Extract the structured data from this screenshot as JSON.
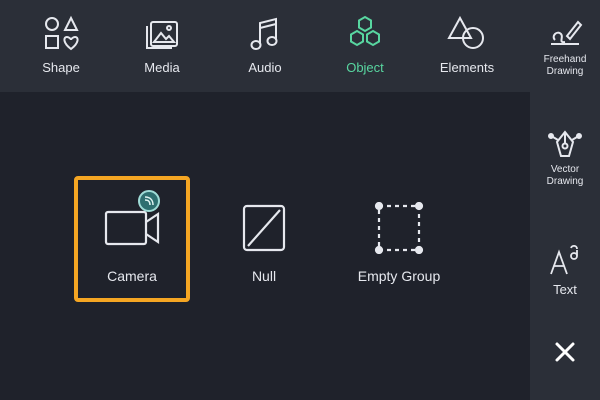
{
  "toolbar": {
    "tabs": [
      {
        "label": "Shape",
        "icon": "shapes-icon"
      },
      {
        "label": "Media",
        "icon": "media-icon"
      },
      {
        "label": "Audio",
        "icon": "music-note-icon"
      },
      {
        "label": "Object",
        "icon": "hexagon-cluster-icon",
        "active": true
      },
      {
        "label": "Elements",
        "icon": "elements-icon"
      }
    ]
  },
  "sidebar": {
    "items": [
      {
        "label": "Freehand\nDrawing",
        "icon": "freehand-pen-icon"
      },
      {
        "label": "Vector\nDrawing",
        "icon": "vector-pen-icon"
      },
      {
        "label": "Text",
        "icon": "text-icon"
      },
      {
        "label": "",
        "icon": "close-icon"
      }
    ]
  },
  "objects": [
    {
      "label": "Camera",
      "icon": "camera-icon",
      "selected": true
    },
    {
      "label": "Null",
      "icon": "null-icon"
    },
    {
      "label": "Empty Group",
      "icon": "empty-group-icon"
    }
  ],
  "colors": {
    "background": "#1f222b",
    "panel": "#2b2f38",
    "accent_active": "#58d6a0",
    "selection": "#f5a623"
  }
}
